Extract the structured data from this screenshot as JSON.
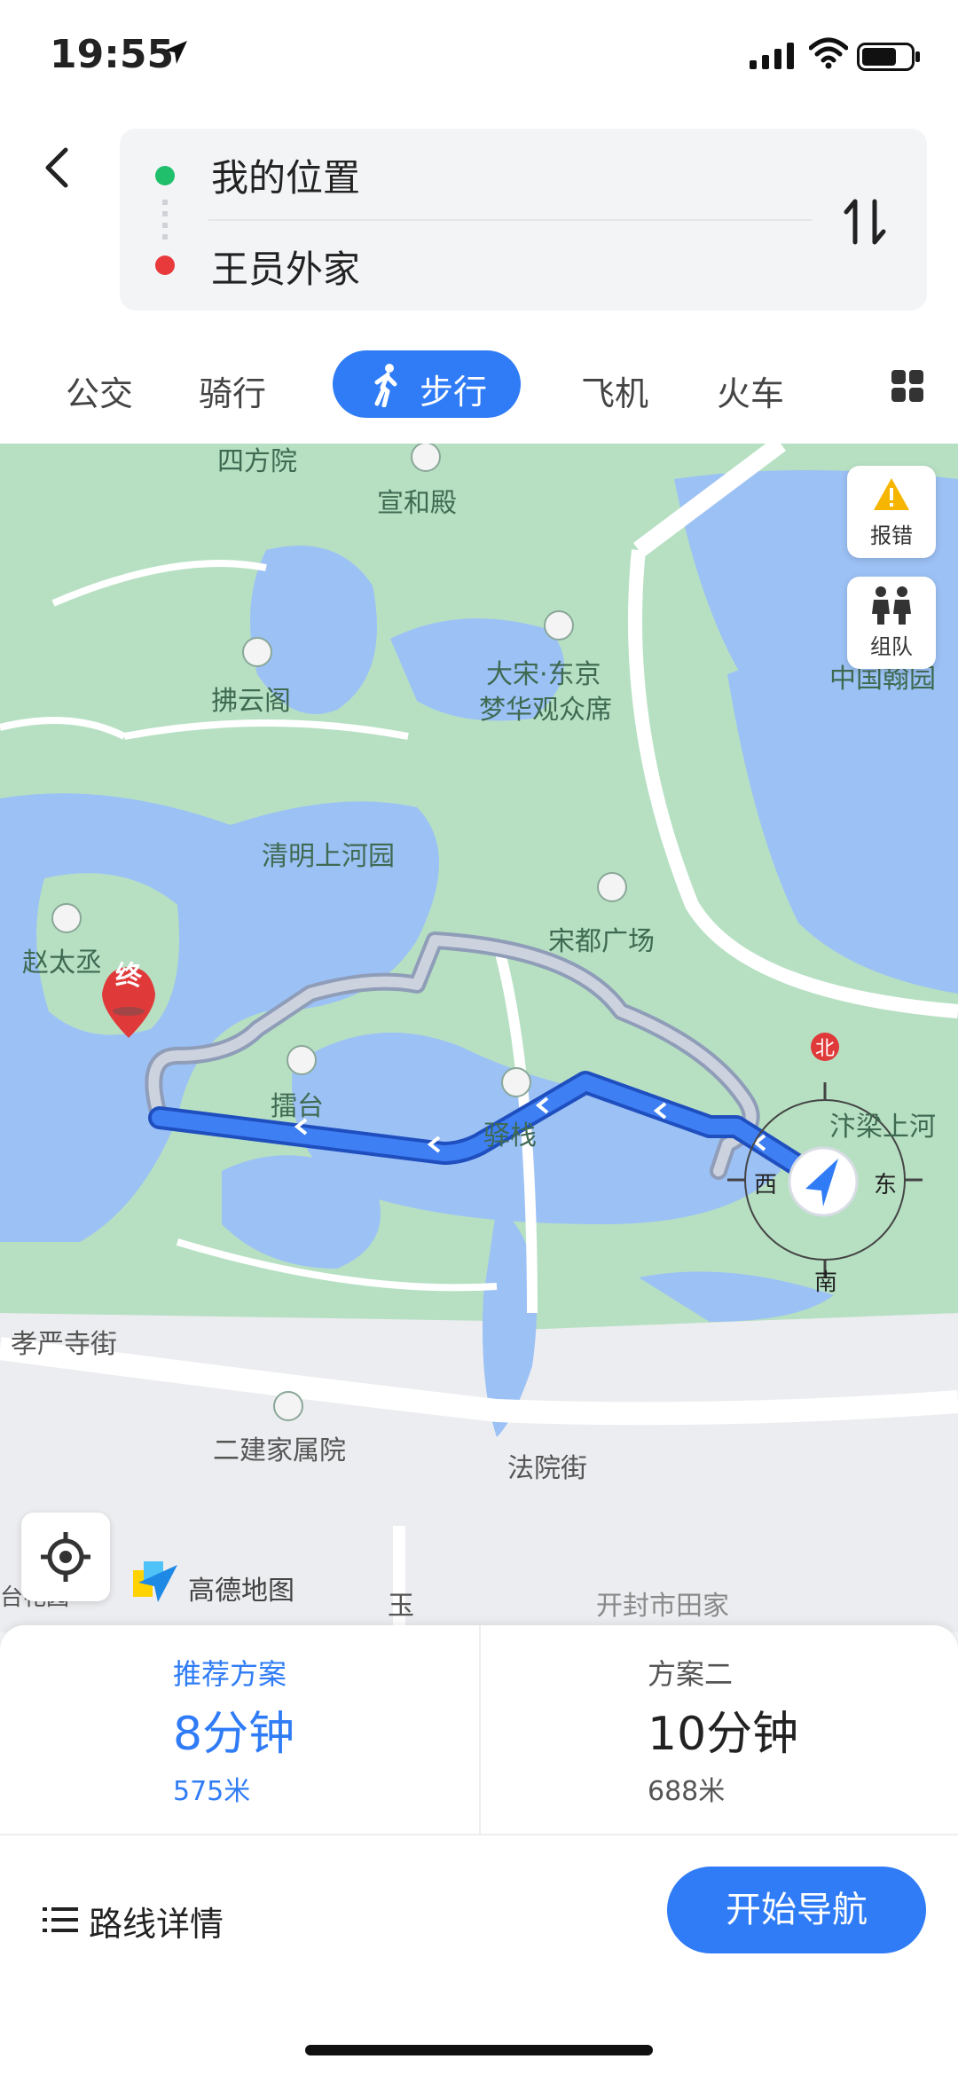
{
  "status_bar": {
    "time": "19:55"
  },
  "route": {
    "from": "我的位置",
    "to": "王员外家"
  },
  "tabs": [
    {
      "label": "公交"
    },
    {
      "label": "骑行"
    },
    {
      "label": "步行",
      "active": true
    },
    {
      "label": "飞机"
    },
    {
      "label": "火车"
    }
  ],
  "map": {
    "buttons": {
      "report": "报错",
      "team": "组队"
    },
    "logo": "高德地图",
    "end_marker": "终",
    "compass": {
      "north": "北",
      "south": "南",
      "east": "东",
      "west": "西"
    },
    "labels": {
      "sifangyuan": "四方院",
      "xuanhedian": "宣和殿",
      "fuyunge": "拂云阁",
      "dasong": "大宋·东京",
      "menghua": "梦华观众席",
      "zhongguo": "中国翰园",
      "qingming": "清明上河园",
      "songdu": "宋都广场",
      "zhaotai": "赵太丞",
      "leitai": "擂台",
      "yizhan": "驿栈",
      "bianliang": "汴梁上河",
      "xiaoyan": "孝严寺街",
      "erjian": "二建家属院",
      "fayuan": "法院街",
      "kaifeng": "开封市田家",
      "yu": "玉",
      "taihua": "台花园"
    }
  },
  "plans": [
    {
      "tag": "推荐方案",
      "duration": "8分钟",
      "distance": "575米"
    },
    {
      "tag": "方案二",
      "duration": "10分钟",
      "distance": "688米"
    }
  ],
  "actions": {
    "details": "路线详情",
    "navigate": "开始导航"
  },
  "colors": {
    "accent": "#2f7cf6",
    "water": "#9cc1f5",
    "park": "#b7e0c3"
  }
}
